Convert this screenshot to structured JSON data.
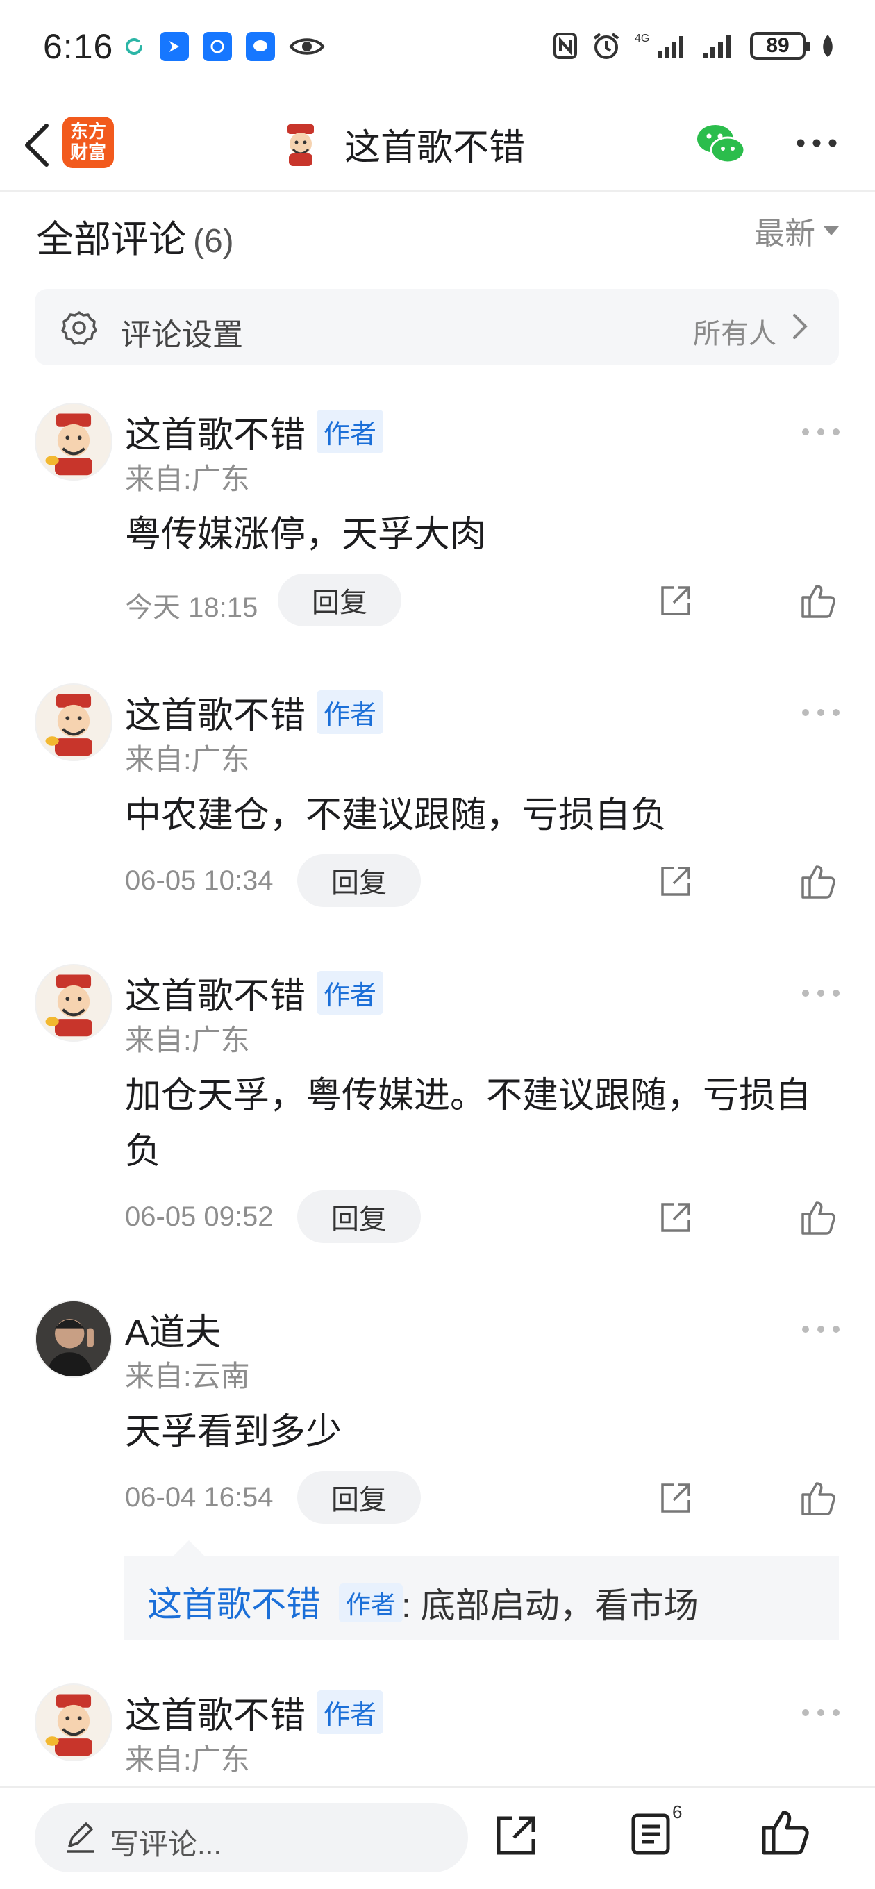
{
  "status_bar": {
    "time": "6:16",
    "battery": "89",
    "network": "4G"
  },
  "header": {
    "app_logo_text": "东方财富",
    "title": "这首歌不错"
  },
  "comments_section": {
    "title": "全部评论",
    "count": "(6)",
    "sort_label": "最新",
    "settings_label": "评论设置",
    "settings_value": "所有人"
  },
  "comments": [
    {
      "name": "这首歌不错",
      "tag": "作者",
      "location": "来自:广东",
      "text": "粤传媒涨停，天孚大肉",
      "time": "今天 18:15",
      "reply_label": "回复"
    },
    {
      "name": "这首歌不错",
      "tag": "作者",
      "location": "来自:广东",
      "text": "中农建仓，不建议跟随，亏损自负",
      "time": "06-05 10:34",
      "reply_label": "回复"
    },
    {
      "name": "这首歌不错",
      "tag": "作者",
      "location": "来自:广东",
      "text": "加仓天孚，粤传媒进。不建议跟随，亏损自负",
      "time": "06-05 09:52",
      "reply_label": "回复"
    },
    {
      "name": "A道夫",
      "tag": "",
      "location": "来自:云南",
      "text": "天孚看到多少",
      "time": "06-04 16:54",
      "reply_label": "回复",
      "reply": {
        "name": "这首歌不错",
        "tag": "作者",
        "text": ": 底部启动，看市场"
      }
    },
    {
      "name": "这首歌不错",
      "tag": "作者",
      "location": "来自:广东"
    }
  ],
  "bottom_bar": {
    "write_placeholder": "写评论...",
    "comment_count": "6"
  },
  "colors": {
    "accent_blue": "#1b6fd8",
    "logo_orange": "#f25a1d",
    "wechat_green": "#2bbd4c"
  }
}
